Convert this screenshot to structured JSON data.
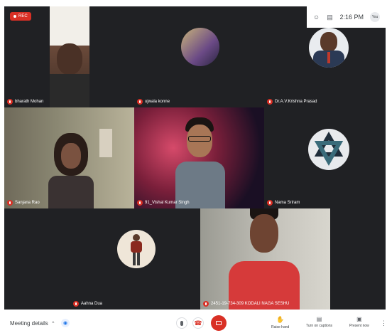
{
  "recording": {
    "label": "REC"
  },
  "topbar": {
    "time": "2:16 PM",
    "user_initials": "You"
  },
  "participants": [
    {
      "name": "bharath Mohan"
    },
    {
      "name": "ujwala konne"
    },
    {
      "name": "Dr.A.V.Krishna Prasad"
    },
    {
      "name": "Sanjana Rao"
    },
    {
      "name": "91_Vishal Kumar Singh"
    },
    {
      "name": "Nama Sriram"
    },
    {
      "name": "Aahna Dua"
    },
    {
      "name": "2451-19-734-309 KODALI NAGA SESHU"
    }
  ],
  "bottombar": {
    "meeting_details": "Meeting details",
    "raise_hand": "Raise hand",
    "captions": "Turn on captions",
    "present": "Present now"
  },
  "colors": {
    "danger": "#d93025",
    "tile_bg": "#3c4043",
    "stage_bg": "#202124"
  }
}
